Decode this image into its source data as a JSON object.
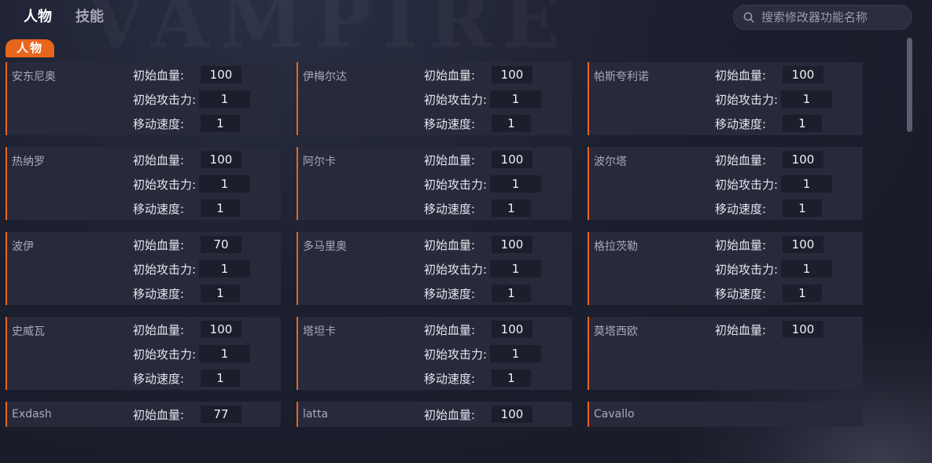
{
  "tabs": [
    {
      "label": "人物",
      "active": true
    },
    {
      "label": "技能",
      "active": false
    }
  ],
  "search": {
    "placeholder": "搜索修改器功能名称"
  },
  "section": {
    "label": "人物"
  },
  "labels": {
    "hp": "初始血量:",
    "atk": "初始攻击力:",
    "spd": "移动速度:"
  },
  "colors": {
    "accent": "#e8651c",
    "card_bg": "#262a3b",
    "page_bg": "#1c1f2e"
  },
  "characters": [
    {
      "name": "安东尼奥",
      "hp": "100",
      "atk": "1",
      "spd": "1"
    },
    {
      "name": "伊梅尔达",
      "hp": "100",
      "atk": "1",
      "spd": "1"
    },
    {
      "name": "帕斯夸利诺",
      "hp": "100",
      "atk": "1",
      "spd": "1"
    },
    {
      "name": "热纳罗",
      "hp": "100",
      "atk": "1",
      "spd": "1"
    },
    {
      "name": "阿尔卡",
      "hp": "100",
      "atk": "1",
      "spd": "1"
    },
    {
      "name": "波尔塔",
      "hp": "100",
      "atk": "1",
      "spd": "1"
    },
    {
      "name": "波伊",
      "hp": "70",
      "atk": "1",
      "spd": "1"
    },
    {
      "name": "多马里奥",
      "hp": "100",
      "atk": "1",
      "spd": "1"
    },
    {
      "name": "格拉茨勒",
      "hp": "100",
      "atk": "1",
      "spd": "1"
    },
    {
      "name": "史威瓦",
      "hp": "100",
      "atk": "1",
      "spd": "1"
    },
    {
      "name": "塔坦卡",
      "hp": "100",
      "atk": "1",
      "spd": "1"
    },
    {
      "name": "莫塔西欧",
      "hp": "100",
      "atk": "",
      "spd": ""
    },
    {
      "name": "Exdash",
      "hp": "77",
      "atk": "",
      "spd": ""
    },
    {
      "name": "latta",
      "hp": "100",
      "atk": "",
      "spd": ""
    },
    {
      "name": "Cavallo",
      "hp": "",
      "atk": "",
      "spd": ""
    }
  ]
}
